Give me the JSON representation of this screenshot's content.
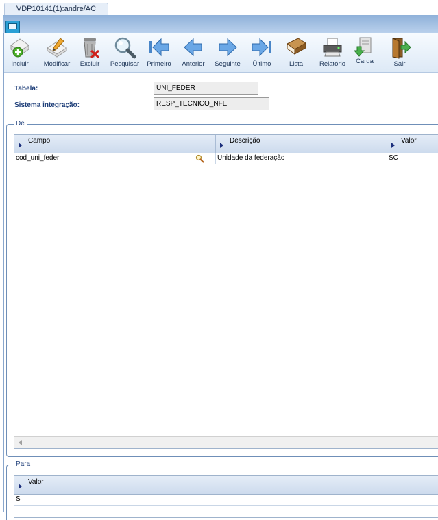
{
  "tab": {
    "title": "VDP10141(1):andre/AC"
  },
  "toolbar": {
    "items": [
      {
        "label": "Incluir",
        "icon": "add-icon"
      },
      {
        "label": "Modificar",
        "icon": "edit-icon"
      },
      {
        "label": "Excluir",
        "icon": "delete-icon"
      },
      {
        "label": "Pesquisar",
        "icon": "search-icon"
      },
      {
        "label": "Primeiro",
        "icon": "first-icon"
      },
      {
        "label": "Anterior",
        "icon": "previous-icon"
      },
      {
        "label": "Seguinte",
        "icon": "next-icon"
      },
      {
        "label": "Último",
        "icon": "last-icon"
      },
      {
        "label": "Lista",
        "icon": "list-icon"
      },
      {
        "label": "Relatório",
        "icon": "printer-icon"
      },
      {
        "label": "Carga",
        "icon": "load-icon"
      },
      {
        "label": "Sair",
        "icon": "exit-icon"
      }
    ]
  },
  "form": {
    "tabela_label": "Tabela:",
    "tabela_value": "UNI_FEDER",
    "sistema_label": "Sistema integração:",
    "sistema_value": "RESP_TECNICO_NFE"
  },
  "de_group": {
    "title": "De",
    "columns": {
      "campo": "Campo",
      "descricao": "Descrição",
      "valor": "Valor"
    },
    "rows": [
      {
        "campo": "cod_uni_feder",
        "descricao": "Unidade da federação",
        "valor": "SC"
      }
    ]
  },
  "para_group": {
    "title": "Para",
    "columns": {
      "valor": "Valor"
    },
    "rows": [
      {
        "valor": "S"
      }
    ]
  },
  "colors": {
    "accent": "#1f3f79",
    "toolbar_bg": "#dde9f6",
    "title_bar": "#8fb1d9"
  }
}
